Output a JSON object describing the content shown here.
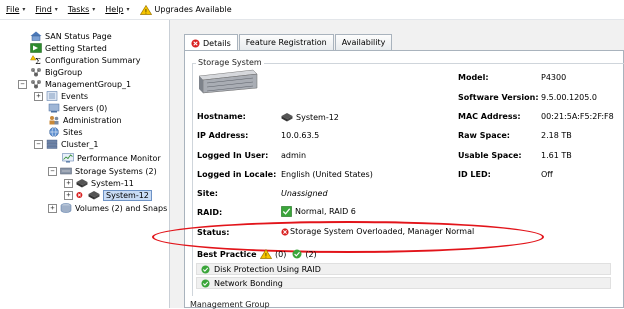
{
  "menu": {
    "items": [
      {
        "label": "File",
        "key": "file"
      },
      {
        "label": "Find",
        "key": "find"
      },
      {
        "label": "Tasks",
        "key": "tasks"
      },
      {
        "label": "Help",
        "key": "help"
      }
    ],
    "upgrades_label": "Upgrades Available"
  },
  "tree": {
    "items": [
      {
        "label": "SAN Status Page",
        "icon": "home-icon"
      },
      {
        "label": "Getting Started",
        "icon": "arrow-icon"
      },
      {
        "label": "Configuration Summary",
        "icon": "summary-icon"
      },
      {
        "label": "BigGroup",
        "icon": "group-icon"
      },
      {
        "label": "ManagementGroup_1",
        "icon": "group-icon"
      },
      {
        "label": "Events",
        "icon": "events-icon"
      },
      {
        "label": "Servers (0)",
        "icon": "server-icon"
      },
      {
        "label": "Administration",
        "icon": "admin-icon"
      },
      {
        "label": "Sites",
        "icon": "globe-icon"
      },
      {
        "label": "Cluster_1",
        "icon": "cluster-icon"
      },
      {
        "label": "Performance Monitor",
        "icon": "monitor-icon"
      },
      {
        "label": "Storage Systems (2)",
        "icon": "storage-icon"
      },
      {
        "label": "System-11",
        "icon": "disk-icon"
      },
      {
        "label": "System-12",
        "icon": "disk-icon"
      },
      {
        "label": "Volumes (2) and Snaps",
        "icon": "volume-icon"
      }
    ]
  },
  "tabs": [
    {
      "label": "Details",
      "active": true
    },
    {
      "label": "Feature Registration",
      "active": false
    },
    {
      "label": "Availability",
      "active": false
    }
  ],
  "details": {
    "section_title": "Storage System",
    "hostname_label": "Hostname:",
    "hostname_value": "System-12",
    "ip_label": "IP Address:",
    "ip_value": "10.0.63.5",
    "logged_user_label": "Logged In User:",
    "logged_user_value": "admin",
    "locale_label": "Logged in Locale:",
    "locale_value": "English (United States)",
    "site_label": "Site:",
    "site_value": "Unassigned",
    "raid_label": "RAID:",
    "raid_value": "Normal, RAID 6",
    "status_label": "Status:",
    "status_value": "Storage System Overloaded, Manager Normal",
    "model_label": "Model:",
    "model_value": "P4300",
    "software_label": "Software Version:",
    "software_value": "9.5.00.1205.0",
    "mac_label": "MAC Address:",
    "mac_value": "00:21:5A:F5:2F:F8",
    "raw_label": "Raw Space:",
    "raw_value": "2.18 TB",
    "usable_label": "Usable Space:",
    "usable_value": "1.61 TB",
    "idled_label": "ID LED:",
    "idled_value": "Off"
  },
  "best_practice": {
    "title": "Best Practice",
    "warn_count": "(0)",
    "ok_count": "(2)",
    "items": [
      "Disk Protection Using RAID",
      "Network Bonding"
    ]
  },
  "bottom_section": "Management Group",
  "colors": {
    "accent": "#e2141a",
    "selection": "#c9dcf5",
    "ok": "#3aa53a",
    "error": "#d92020"
  }
}
